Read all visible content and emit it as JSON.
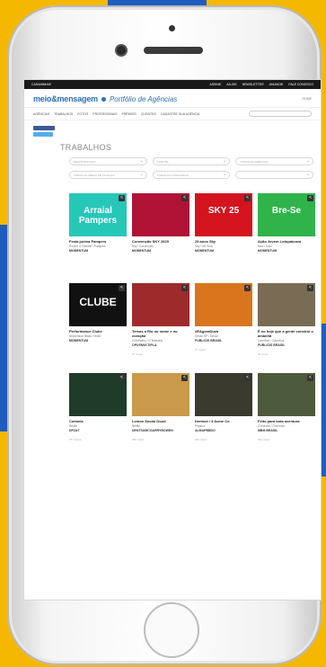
{
  "site": {
    "topbar_brand": "CASA/MM/AE",
    "topbar_links": [
      "ASSINE",
      "AJUDE",
      "NEWSLETTER",
      "ANUNCIE",
      "FALE CONOSCO"
    ],
    "logo": "meio&mensagem",
    "portal": "Portfólio de Agências",
    "right_link": "HOME",
    "nav": [
      "AGÊNCIAS",
      "TRABALHOS",
      "FOTOS",
      "PROFISSIONAIS",
      "PRÊMIOS",
      "CLIENTES",
      "CADASTRE SUA AGÊNCIA"
    ],
    "section_title": "TRABALHOS",
    "filters": [
      "REGIÃO/ESTADO",
      "CLIENTE",
      "TODAS AS AGÊNCIAS",
      "TODAS AS ÁREAS DE ATUAÇÃO",
      "TODAS AS CATEGORIAS",
      ""
    ]
  },
  "cards": [
    {
      "title": "Festa junina Pampers",
      "sub": "Procter & Gamble / Pampers",
      "agency": "MOMENTUM",
      "views": "",
      "bg": "#27c7b8",
      "label": "Arraial Pampers"
    },
    {
      "title": "Convenção SKY 2025",
      "sub": "Sky / Convenção",
      "agency": "MOMENTUM",
      "views": "",
      "bg": "#b01236",
      "label": ""
    },
    {
      "title": "25 anos Sky",
      "sub": "Sky / Alô Sola",
      "agency": "MOMENTUM",
      "views": "",
      "bg": "#d4131f",
      "label": "SKY 25"
    },
    {
      "title": "Ação Jovem Lotopalooza",
      "sub": "Nacl / Nacl",
      "agency": "MOMENTUM",
      "views": "",
      "bg": "#2fb34a",
      "label": "Bre-Se"
    },
    {
      "title": "Performance Clube",
      "sub": "Momentum Brasil / Mobil",
      "agency": "MOMENTUM",
      "views": "",
      "bg": "#111111",
      "label": "CLUBE"
    },
    {
      "title": "Temos a Rio no nome e no coração",
      "sub": "O Boticário / O Boticário",
      "agency": "OPUSMULTIPLA",
      "views": "27 views",
      "bg": "#9e2b2b",
      "label": ""
    },
    {
      "title": "#ÉAgoraDuzá",
      "sub": "Senac SP / Senac",
      "agency": "PUBLICIS BRASIL",
      "views": "27 views",
      "bg": "#d9751d",
      "label": ""
    },
    {
      "title": "É no hoje que a gente constrói o amanhã",
      "sub": "Carrefour / Carrefour",
      "agency": "PUBLICIS BRASIL",
      "views": "30 views",
      "bg": "#7a6b55",
      "label": ""
    },
    {
      "title": "Colmeia",
      "sub": "Nestlé",
      "agency": "DPZ&T",
      "views": "757 views",
      "bg": "#1f3b2a",
      "label": ""
    },
    {
      "title": "Lemon Social Good",
      "sub": "Nestlé",
      "agency": "DENTSUMCGARRYBOWEN",
      "views": "366 views",
      "bg": "#c99a49",
      "label": ""
    },
    {
      "title": "Dentsol / 3 Acme Co",
      "sub": "Pepsico",
      "agency": "ALMAPBBDO",
      "views": "182 views",
      "bg": "#3a3a2e",
      "label": ""
    },
    {
      "title": "Feito para toda aventura",
      "sub": "Chevrolet / Chevrolet",
      "agency": "MBM BRASIL",
      "views": "394 views",
      "bg": "#4e5a3c",
      "label": ""
    }
  ]
}
